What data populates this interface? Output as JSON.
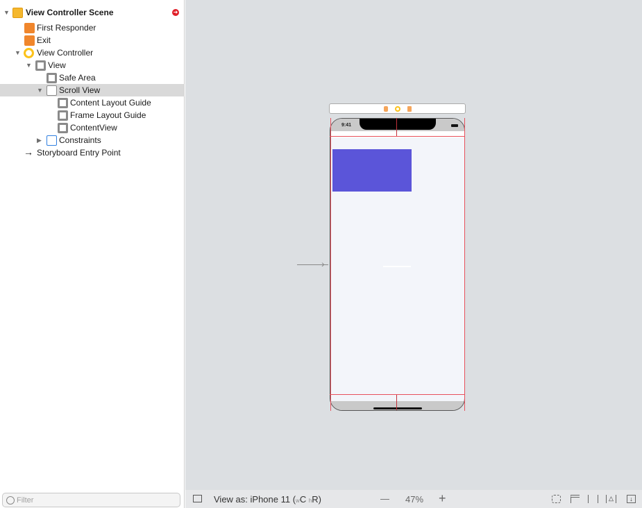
{
  "outline": {
    "scene": "View Controller Scene",
    "items": [
      {
        "label": "First Responder",
        "icon": "first-responder-icon"
      },
      {
        "label": "Exit",
        "icon": "exit-icon"
      },
      {
        "label": "View Controller",
        "icon": "view-controller-icon"
      },
      {
        "label": "View",
        "icon": "view-icon"
      },
      {
        "label": "Safe Area",
        "icon": "layout-guide-icon"
      },
      {
        "label": "Scroll View",
        "icon": "scroll-view-icon"
      },
      {
        "label": "Content Layout Guide",
        "icon": "layout-guide-icon"
      },
      {
        "label": "Frame Layout Guide",
        "icon": "layout-guide-icon"
      },
      {
        "label": "ContentView",
        "icon": "view-icon"
      },
      {
        "label": "Constraints",
        "icon": "constraints-icon"
      },
      {
        "label": "Storyboard Entry Point",
        "icon": "arrow-right-icon"
      }
    ],
    "selected": "Scroll View",
    "filter_placeholder": "Filter"
  },
  "device": {
    "time": "9:41",
    "content_color": "#5b55d9",
    "constraint_color": "#e8505b"
  },
  "bottombar": {
    "view_as": "View as: iPhone 11 (",
    "w": "w",
    "wc": "C",
    "h": "h",
    "hr": "R)",
    "zoom_out": "—",
    "zoom": "47%",
    "zoom_in": "+"
  }
}
